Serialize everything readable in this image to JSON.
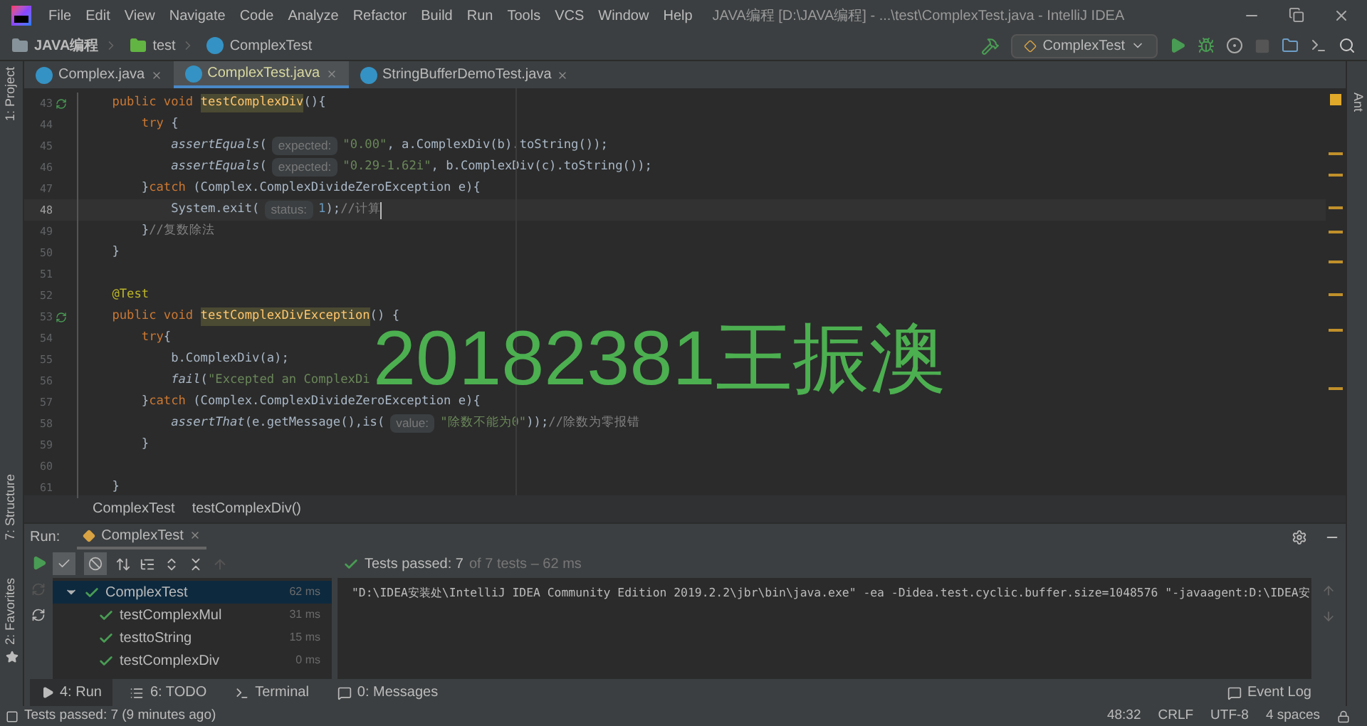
{
  "menu": [
    "File",
    "Edit",
    "View",
    "Navigate",
    "Code",
    "Analyze",
    "Refactor",
    "Build",
    "Run",
    "Tools",
    "VCS",
    "Window",
    "Help"
  ],
  "window": {
    "title": "JAVA编程 [D:\\JAVA编程] - ...\\test\\ComplexTest.java - IntelliJ IDEA"
  },
  "navigation": [
    {
      "kind": "project",
      "label": "JAVA编程"
    },
    {
      "kind": "folder",
      "label": "test"
    },
    {
      "kind": "class",
      "label": "ComplexTest"
    }
  ],
  "run_config": "ComplexTest",
  "left_stripe": [
    "1: Project",
    "7: Structure",
    "2: Favorites"
  ],
  "right_stripe": [
    "Ant"
  ],
  "tabs": [
    {
      "label": "Complex.java",
      "selected": false
    },
    {
      "label": "ComplexTest.java",
      "selected": true
    },
    {
      "label": "StringBufferDemoTest.java",
      "selected": false
    }
  ],
  "editor": {
    "lines": [
      {
        "num": "43",
        "run": true,
        "current": false,
        "tokens": [
          {
            "kind": "kw",
            "text": "    public void "
          },
          {
            "kind": "decl",
            "text": "testComplexDiv"
          },
          {
            "kind": "plain",
            "text": "(){"
          }
        ]
      },
      {
        "num": "44",
        "run": false,
        "current": false,
        "tokens": [
          {
            "kind": "kw",
            "text": "        try "
          },
          {
            "kind": "plain",
            "text": "{"
          }
        ]
      },
      {
        "num": "45",
        "run": false,
        "current": false,
        "tokens": [
          {
            "kind": "call",
            "text": "            assertEquals"
          },
          {
            "kind": "plain",
            "text": "("
          },
          {
            "kind": "hint",
            "text": "expected:"
          },
          {
            "kind": "str",
            "text": "\"0.00\""
          },
          {
            "kind": "plain",
            "text": ", a.ComplexDiv(b).toString());"
          }
        ]
      },
      {
        "num": "46",
        "run": false,
        "current": false,
        "tokens": [
          {
            "kind": "call",
            "text": "            assertEquals"
          },
          {
            "kind": "plain",
            "text": "("
          },
          {
            "kind": "hint",
            "text": "expected:"
          },
          {
            "kind": "str",
            "text": "\"0.29-1.62i\""
          },
          {
            "kind": "plain",
            "text": ", b.ComplexDiv(c).toString());"
          }
        ]
      },
      {
        "num": "47",
        "run": false,
        "current": false,
        "tokens": [
          {
            "kind": "plain",
            "text": "        }"
          },
          {
            "kind": "kw",
            "text": "catch "
          },
          {
            "kind": "plain",
            "text": "(Complex.ComplexDivideZeroException e){"
          }
        ]
      },
      {
        "num": "48",
        "run": false,
        "current": true,
        "tokens": [
          {
            "kind": "plain",
            "text": "            System.exit("
          },
          {
            "kind": "hint",
            "text": "status:"
          },
          {
            "kind": "num",
            "text": "1"
          },
          {
            "kind": "plain",
            "text": ");"
          },
          {
            "kind": "comment",
            "text": "//计算"
          }
        ]
      },
      {
        "num": "49",
        "run": false,
        "current": false,
        "tokens": [
          {
            "kind": "plain",
            "text": "        }"
          },
          {
            "kind": "comment",
            "text": "//复数除法"
          }
        ]
      },
      {
        "num": "50",
        "run": false,
        "current": false,
        "tokens": [
          {
            "kind": "plain",
            "text": "    }"
          }
        ]
      },
      {
        "num": "51",
        "run": false,
        "current": false
      },
      {
        "num": "52",
        "run": false,
        "current": false,
        "tokens": [
          {
            "kind": "annotation",
            "text": "    @Test"
          }
        ]
      },
      {
        "num": "53",
        "run": true,
        "current": false,
        "tokens": [
          {
            "kind": "kw",
            "text": "    public void "
          },
          {
            "kind": "decl",
            "text": "testComplexDivException"
          },
          {
            "kind": "plain",
            "text": "() {"
          }
        ]
      },
      {
        "num": "54",
        "run": false,
        "current": false,
        "tokens": [
          {
            "kind": "kw",
            "text": "        try"
          },
          {
            "kind": "plain",
            "text": "{"
          }
        ]
      },
      {
        "num": "55",
        "run": false,
        "current": false,
        "tokens": [
          {
            "kind": "plain",
            "text": "            b.ComplexDiv(a);"
          }
        ]
      },
      {
        "num": "56",
        "run": false,
        "current": false,
        "tokens": [
          {
            "kind": "call",
            "text": "            fail"
          },
          {
            "kind": "plain",
            "text": "("
          },
          {
            "kind": "str",
            "text": "\"Excepted an ComplexDi"
          }
        ]
      },
      {
        "num": "57",
        "run": false,
        "current": false,
        "tokens": [
          {
            "kind": "plain",
            "text": "        }"
          },
          {
            "kind": "kw",
            "text": "catch "
          },
          {
            "kind": "plain",
            "text": "(Complex.ComplexDivideZeroException e){"
          }
        ]
      },
      {
        "num": "58",
        "run": false,
        "current": false,
        "tokens": [
          {
            "kind": "call",
            "text": "            assertThat"
          },
          {
            "kind": "plain",
            "text": "(e.getMessage(),is("
          },
          {
            "kind": "hint",
            "text": "value:"
          },
          {
            "kind": "str",
            "text": "\"除数不能为0\""
          },
          {
            "kind": "plain",
            "text": "));"
          },
          {
            "kind": "comment",
            "text": "//除数为零报错"
          }
        ]
      },
      {
        "num": "59",
        "run": false,
        "current": false,
        "tokens": [
          {
            "kind": "plain",
            "text": "        }"
          }
        ]
      },
      {
        "num": "60",
        "run": false,
        "current": false
      },
      {
        "num": "61",
        "run": false,
        "current": false,
        "tokens": [
          {
            "kind": "plain",
            "text": "    }"
          }
        ]
      }
    ]
  },
  "overlay_text": "20182381王振澳",
  "breadcrumbs": [
    "ComplexTest",
    "testComplexDiv()"
  ],
  "run": {
    "label": "Run:",
    "tab": "ComplexTest",
    "status": "Tests passed: 7",
    "status_rest": "of 7 tests – 62 ms",
    "tree": [
      {
        "name": "ComplexTest",
        "time": "62 ms",
        "selected": true,
        "expanded": true,
        "children": [
          {
            "name": "testComplexMul",
            "time": "31 ms",
            "selected": false
          },
          {
            "name": "testtoString",
            "time": "15 ms",
            "selected": false
          },
          {
            "name": "testComplexDiv",
            "time": "0 ms",
            "selected": false
          }
        ]
      }
    ],
    "console": "\"D:\\IDEA安装处\\IntelliJ IDEA Community Edition 2019.2.2\\jbr\\bin\\java.exe\" -ea -Didea.test.cyclic.buffer.size=1048576 \"-javaagent:D:\\IDEA安"
  },
  "bottom_tabs": [
    {
      "label": "4: Run",
      "selected": true
    },
    {
      "label": "6: TODO",
      "selected": false
    },
    {
      "label": "Terminal",
      "selected": false
    },
    {
      "label": "0: Messages",
      "selected": false
    }
  ],
  "event_log": "Event Log",
  "status_bar": {
    "message": "Tests passed: 7 (9 minutes ago)",
    "items": [
      "48:32",
      "CRLF",
      "UTF-8",
      "4 spaces"
    ]
  }
}
